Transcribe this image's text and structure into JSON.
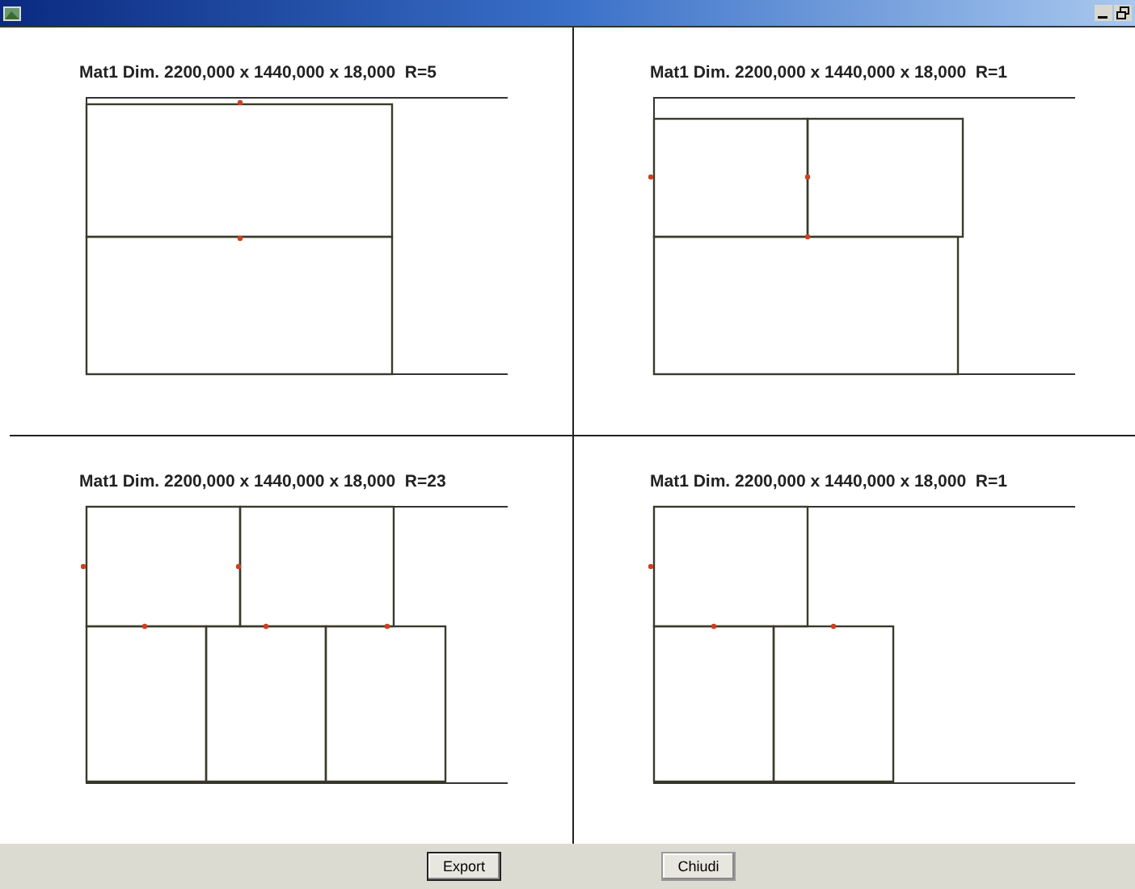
{
  "panels": [
    {
      "title": "Mat1 Dim. 2200,000 x 1440,000 x 18,000  R=5"
    },
    {
      "title": "Mat1 Dim. 2200,000 x 1440,000 x 18,000  R=1"
    },
    {
      "title": "Mat1 Dim. 2200,000 x 1440,000 x 18,000  R=23"
    },
    {
      "title": "Mat1 Dim. 2200,000 x 1440,000 x 18,000  R=1"
    }
  ],
  "buttons": [
    "Export",
    "Chiudi"
  ]
}
